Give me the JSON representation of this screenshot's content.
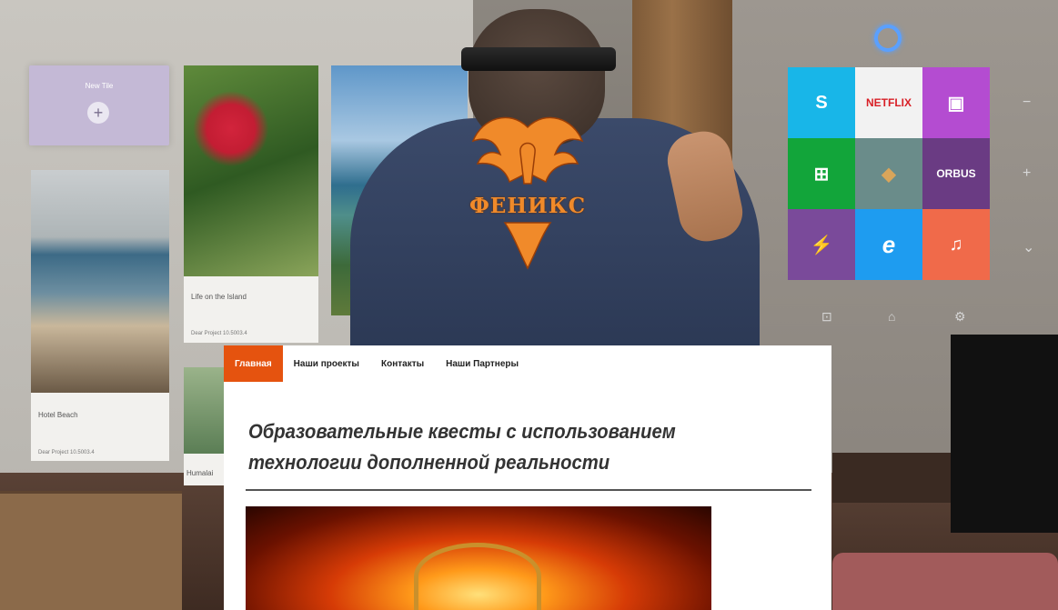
{
  "scene": {
    "new_tile_label": "New Tile",
    "cards": [
      {
        "title": "Hotel Beach",
        "meta": "Dear Project 10.5003.4"
      },
      {
        "title": "Life on the Island",
        "meta": "Dear Project 10.5003.4"
      },
      {
        "title": "Humalai",
        "meta": ""
      }
    ],
    "logo_text": "ФЕНИКС"
  },
  "start_tiles": [
    {
      "name": "skype",
      "glyph": "S",
      "color": "#18b6e8"
    },
    {
      "name": "netflix",
      "glyph": "NETFLIX",
      "color": "#f2f2f2",
      "fg": "#d81f26"
    },
    {
      "name": "app-purple",
      "glyph": "▣",
      "color": "#b44cd1"
    },
    {
      "name": "store",
      "glyph": "⊞",
      "color": "#12a53a"
    },
    {
      "name": "game-cube",
      "glyph": "◆",
      "color": "#6a8c8a"
    },
    {
      "name": "orbus",
      "glyph": "ORBUS",
      "color": "#6a3b83"
    },
    {
      "name": "energy",
      "glyph": "⚡",
      "color": "#7a4a9a"
    },
    {
      "name": "internet-explorer",
      "glyph": "e",
      "color": "#1e9cf0"
    },
    {
      "name": "music",
      "glyph": "🎧",
      "color": "#f06a4a"
    }
  ],
  "side_controls": [
    "−",
    "+",
    "⌄"
  ],
  "bottom_controls": [
    "⊡",
    "⌂",
    "⚙"
  ],
  "website": {
    "nav": [
      {
        "label": "Главная",
        "active": true
      },
      {
        "label": "Наши проекты",
        "active": false
      },
      {
        "label": "Контакты",
        "active": false
      },
      {
        "label": "Наши Партнеры",
        "active": false
      }
    ],
    "headline_line1": "Образовательные квесты с использованием",
    "headline_line2": "технологии дополненной реальности"
  }
}
